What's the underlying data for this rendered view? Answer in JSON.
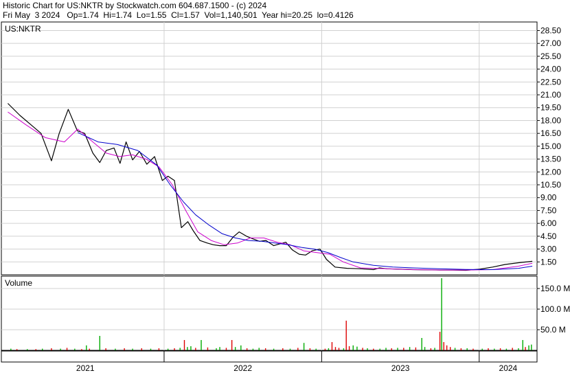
{
  "header": {
    "line1": "Historic Chart for US:NKTR by Stockwatch.com 604.687.1500 - (c) 2024",
    "line2": "Fri May  3 2024   Op=1.74  Hi=1.74  Lo=1.55  Cl=1.57  Vol=1,140,501  Year hi=20.25  lo=0.4126"
  },
  "chart_data": [
    {
      "type": "line",
      "title": "US:NKTR",
      "x_labels": [
        "2021",
        "2022",
        "2023",
        "2024"
      ],
      "ylim": [
        0,
        29.5
      ],
      "y_ticks": [
        "28.50",
        "27.00",
        "25.50",
        "24.00",
        "22.50",
        "21.00",
        "19.50",
        "18.00",
        "16.50",
        "15.00",
        "13.50",
        "12.00",
        "10.50",
        "9.00",
        "7.50",
        "6.00",
        "4.50",
        "3.00",
        "1.50"
      ],
      "grid": true,
      "series": [
        {
          "color": "#000000",
          "x": [
            "2021-01-04",
            "2021-02-01",
            "2021-03-01",
            "2021-03-22",
            "2021-04-15",
            "2021-05-03",
            "2021-05-24",
            "2021-06-14",
            "2021-07-01",
            "2021-07-20",
            "2021-08-05",
            "2021-08-20",
            "2021-09-07",
            "2021-09-21",
            "2021-10-05",
            "2021-10-20",
            "2021-11-05",
            "2021-11-22",
            "2021-12-10",
            "2021-12-28",
            "2022-01-10",
            "2022-01-25",
            "2022-02-10",
            "2022-02-25",
            "2022-03-10",
            "2022-03-25",
            "2022-04-11",
            "2022-04-25",
            "2022-05-10",
            "2022-05-25",
            "2022-06-10",
            "2022-06-24",
            "2022-07-11",
            "2022-07-25",
            "2022-08-10",
            "2022-08-25",
            "2022-09-12",
            "2022-09-26",
            "2022-10-10",
            "2022-10-25",
            "2022-11-10",
            "2022-11-25",
            "2022-12-10",
            "2022-12-28",
            "2023-01-12",
            "2023-02-01",
            "2023-03-01",
            "2023-04-03",
            "2023-05-01",
            "2023-05-15",
            "2023-06-01",
            "2023-07-03",
            "2023-08-01",
            "2023-09-01",
            "2023-10-02",
            "2023-11-01",
            "2023-12-01",
            "2024-01-02",
            "2024-02-01",
            "2024-03-01",
            "2024-04-01",
            "2024-05-03"
          ],
          "y": [
            20.0,
            18.6,
            17.4,
            16.5,
            13.3,
            16.5,
            19.3,
            16.8,
            16.5,
            14.2,
            13.1,
            14.5,
            14.8,
            13.0,
            15.5,
            13.4,
            14.4,
            12.9,
            13.8,
            11.0,
            11.5,
            11.0,
            5.5,
            6.2,
            5.1,
            4.0,
            3.7,
            3.5,
            3.4,
            3.4,
            4.4,
            5.0,
            4.5,
            4.2,
            3.9,
            4.0,
            3.4,
            3.6,
            3.8,
            2.9,
            2.4,
            2.3,
            2.8,
            3.0,
            1.8,
            0.9,
            0.75,
            0.7,
            0.6,
            0.8,
            0.7,
            0.65,
            0.6,
            0.58,
            0.55,
            0.55,
            0.52,
            0.65,
            0.9,
            1.2,
            1.4,
            1.57
          ]
        },
        {
          "color": "#cc00cc",
          "x": [
            "2021-01-04",
            "2021-02-15",
            "2021-04-01",
            "2021-05-15",
            "2021-06-15",
            "2021-07-20",
            "2021-08-20",
            "2021-09-20",
            "2021-10-20",
            "2021-11-20",
            "2021-12-20",
            "2022-01-20",
            "2022-02-20",
            "2022-03-20",
            "2022-04-20",
            "2022-05-20",
            "2022-06-20",
            "2022-07-20",
            "2022-08-20",
            "2022-09-20",
            "2022-10-20",
            "2022-11-20",
            "2022-12-20",
            "2023-01-20",
            "2023-02-20",
            "2023-04-01",
            "2023-06-01",
            "2023-08-01",
            "2023-10-01",
            "2023-12-01",
            "2024-02-01",
            "2024-04-01",
            "2024-05-03"
          ],
          "y": [
            19.0,
            17.5,
            16.0,
            15.5,
            17.0,
            15.5,
            14.2,
            13.8,
            14.0,
            13.5,
            12.6,
            10.5,
            7.5,
            5.0,
            4.0,
            3.5,
            3.7,
            4.3,
            4.3,
            3.8,
            3.5,
            2.8,
            2.6,
            2.4,
            1.5,
            0.8,
            0.7,
            0.6,
            0.55,
            0.55,
            0.6,
            1.0,
            1.35
          ]
        },
        {
          "color": "#0000cc",
          "x": [
            "2021-06-15",
            "2021-08-01",
            "2021-09-15",
            "2021-11-01",
            "2021-12-15",
            "2022-01-15",
            "2022-02-15",
            "2022-03-15",
            "2022-04-15",
            "2022-05-15",
            "2022-06-15",
            "2022-07-15",
            "2022-08-15",
            "2022-09-15",
            "2022-10-15",
            "2022-11-15",
            "2022-12-15",
            "2023-01-15",
            "2023-02-15",
            "2023-03-15",
            "2023-05-01",
            "2023-06-15",
            "2023-08-01",
            "2023-10-01",
            "2023-12-01",
            "2024-02-01",
            "2024-04-01",
            "2024-05-03"
          ],
          "y": [
            16.6,
            15.5,
            15.2,
            14.5,
            12.8,
            10.5,
            8.5,
            7.0,
            5.8,
            4.8,
            4.3,
            4.0,
            3.9,
            3.7,
            3.5,
            3.2,
            3.0,
            2.6,
            2.0,
            1.5,
            1.1,
            0.9,
            0.8,
            0.7,
            0.62,
            0.6,
            0.75,
            1.0
          ]
        }
      ]
    },
    {
      "type": "bar",
      "title": "Volume",
      "y_ticks": [
        "150.0 M",
        "100.0 M",
        "50.0 M"
      ],
      "ylim": [
        0,
        180
      ],
      "up_color": "#00aa00",
      "down_color": "#dd0000",
      "bars": [
        {
          "x": "2021-01-11",
          "v": 4,
          "up": true
        },
        {
          "x": "2021-01-25",
          "v": 3,
          "up": false
        },
        {
          "x": "2021-02-18",
          "v": 3,
          "up": true
        },
        {
          "x": "2021-03-10",
          "v": 3,
          "up": false
        },
        {
          "x": "2021-03-25",
          "v": 4,
          "up": true
        },
        {
          "x": "2021-04-15",
          "v": 5,
          "up": false
        },
        {
          "x": "2021-05-06",
          "v": 4,
          "up": true
        },
        {
          "x": "2021-05-21",
          "v": 6,
          "up": false
        },
        {
          "x": "2021-06-08",
          "v": 4,
          "up": true
        },
        {
          "x": "2021-06-24",
          "v": 3,
          "up": false
        },
        {
          "x": "2021-07-05",
          "v": 12,
          "up": true
        },
        {
          "x": "2021-07-12",
          "v": 4,
          "up": false
        },
        {
          "x": "2021-08-05",
          "v": 35,
          "up": true
        },
        {
          "x": "2021-08-19",
          "v": 5,
          "up": false
        },
        {
          "x": "2021-09-10",
          "v": 4,
          "up": true
        },
        {
          "x": "2021-10-01",
          "v": 5,
          "up": false
        },
        {
          "x": "2021-10-20",
          "v": 4,
          "up": true
        },
        {
          "x": "2021-11-10",
          "v": 5,
          "up": false
        },
        {
          "x": "2021-12-01",
          "v": 4,
          "up": true
        },
        {
          "x": "2021-12-20",
          "v": 5,
          "up": false
        },
        {
          "x": "2022-01-10",
          "v": 4,
          "up": true
        },
        {
          "x": "2022-01-25",
          "v": 5,
          "up": false
        },
        {
          "x": "2022-02-07",
          "v": 6,
          "up": true
        },
        {
          "x": "2022-02-17",
          "v": 25,
          "up": false
        },
        {
          "x": "2022-02-24",
          "v": 8,
          "up": true
        },
        {
          "x": "2022-03-04",
          "v": 10,
          "up": true
        },
        {
          "x": "2022-03-15",
          "v": 6,
          "up": false
        },
        {
          "x": "2022-03-28",
          "v": 25,
          "up": true
        },
        {
          "x": "2022-04-12",
          "v": 7,
          "up": false
        },
        {
          "x": "2022-05-02",
          "v": 5,
          "up": true
        },
        {
          "x": "2022-05-10",
          "v": 8,
          "up": true
        },
        {
          "x": "2022-05-25",
          "v": 6,
          "up": false
        },
        {
          "x": "2022-06-07",
          "v": 25,
          "up": false
        },
        {
          "x": "2022-06-15",
          "v": 8,
          "up": true
        },
        {
          "x": "2022-06-28",
          "v": 12,
          "up": true
        },
        {
          "x": "2022-07-12",
          "v": 5,
          "up": false
        },
        {
          "x": "2022-07-26",
          "v": 4,
          "up": true
        },
        {
          "x": "2022-08-09",
          "v": 6,
          "up": true
        },
        {
          "x": "2022-08-24",
          "v": 5,
          "up": false
        },
        {
          "x": "2022-09-12",
          "v": 4,
          "up": true
        },
        {
          "x": "2022-10-03",
          "v": 5,
          "up": false
        },
        {
          "x": "2022-10-20",
          "v": 4,
          "up": true
        },
        {
          "x": "2022-11-07",
          "v": 6,
          "up": false
        },
        {
          "x": "2022-11-21",
          "v": 18,
          "up": true
        },
        {
          "x": "2022-12-05",
          "v": 5,
          "up": false
        },
        {
          "x": "2022-12-19",
          "v": 4,
          "up": true
        },
        {
          "x": "2023-01-09",
          "v": 4,
          "up": false
        },
        {
          "x": "2023-01-17",
          "v": 5,
          "up": true
        },
        {
          "x": "2023-01-25",
          "v": 20,
          "up": false
        },
        {
          "x": "2023-02-02",
          "v": 8,
          "up": false
        },
        {
          "x": "2023-02-10",
          "v": 6,
          "up": false
        },
        {
          "x": "2023-02-21",
          "v": 5,
          "up": true
        },
        {
          "x": "2023-02-27",
          "v": 72,
          "up": false
        },
        {
          "x": "2023-03-06",
          "v": 10,
          "up": false
        },
        {
          "x": "2023-03-15",
          "v": 12,
          "up": true
        },
        {
          "x": "2023-03-24",
          "v": 9,
          "up": true
        },
        {
          "x": "2023-04-06",
          "v": 6,
          "up": false
        },
        {
          "x": "2023-04-17",
          "v": 5,
          "up": true
        },
        {
          "x": "2023-05-01",
          "v": 4,
          "up": false
        },
        {
          "x": "2023-05-16",
          "v": 4,
          "up": true
        },
        {
          "x": "2023-05-30",
          "v": 6,
          "up": true
        },
        {
          "x": "2023-06-12",
          "v": 5,
          "up": false
        },
        {
          "x": "2023-06-26",
          "v": 6,
          "up": true
        },
        {
          "x": "2023-07-10",
          "v": 6,
          "up": false
        },
        {
          "x": "2023-07-24",
          "v": 8,
          "up": true
        },
        {
          "x": "2023-08-07",
          "v": 7,
          "up": false
        },
        {
          "x": "2023-08-21",
          "v": 30,
          "up": true
        },
        {
          "x": "2023-08-28",
          "v": 8,
          "up": true
        },
        {
          "x": "2023-09-11",
          "v": 5,
          "up": false
        },
        {
          "x": "2023-09-20",
          "v": 6,
          "up": true
        },
        {
          "x": "2023-10-02",
          "v": 45,
          "up": false
        },
        {
          "x": "2023-10-06",
          "v": 175,
          "up": true
        },
        {
          "x": "2023-10-11",
          "v": 20,
          "up": false
        },
        {
          "x": "2023-10-18",
          "v": 12,
          "up": false
        },
        {
          "x": "2023-10-26",
          "v": 8,
          "up": false
        },
        {
          "x": "2023-11-06",
          "v": 6,
          "up": true
        },
        {
          "x": "2023-11-20",
          "v": 5,
          "up": false
        },
        {
          "x": "2023-12-04",
          "v": 5,
          "up": true
        },
        {
          "x": "2023-12-18",
          "v": 4,
          "up": false
        },
        {
          "x": "2024-01-08",
          "v": 4,
          "up": true
        },
        {
          "x": "2024-01-22",
          "v": 5,
          "up": false
        },
        {
          "x": "2024-02-05",
          "v": 4,
          "up": true
        },
        {
          "x": "2024-02-19",
          "v": 5,
          "up": false
        },
        {
          "x": "2024-03-04",
          "v": 4,
          "up": true
        },
        {
          "x": "2024-03-18",
          "v": 6,
          "up": false
        },
        {
          "x": "2024-04-01",
          "v": 5,
          "up": true
        },
        {
          "x": "2024-04-11",
          "v": 25,
          "up": true
        },
        {
          "x": "2024-04-17",
          "v": 8,
          "up": false
        },
        {
          "x": "2024-04-25",
          "v": 12,
          "up": true
        },
        {
          "x": "2024-05-01",
          "v": 14,
          "up": true
        }
      ]
    }
  ]
}
